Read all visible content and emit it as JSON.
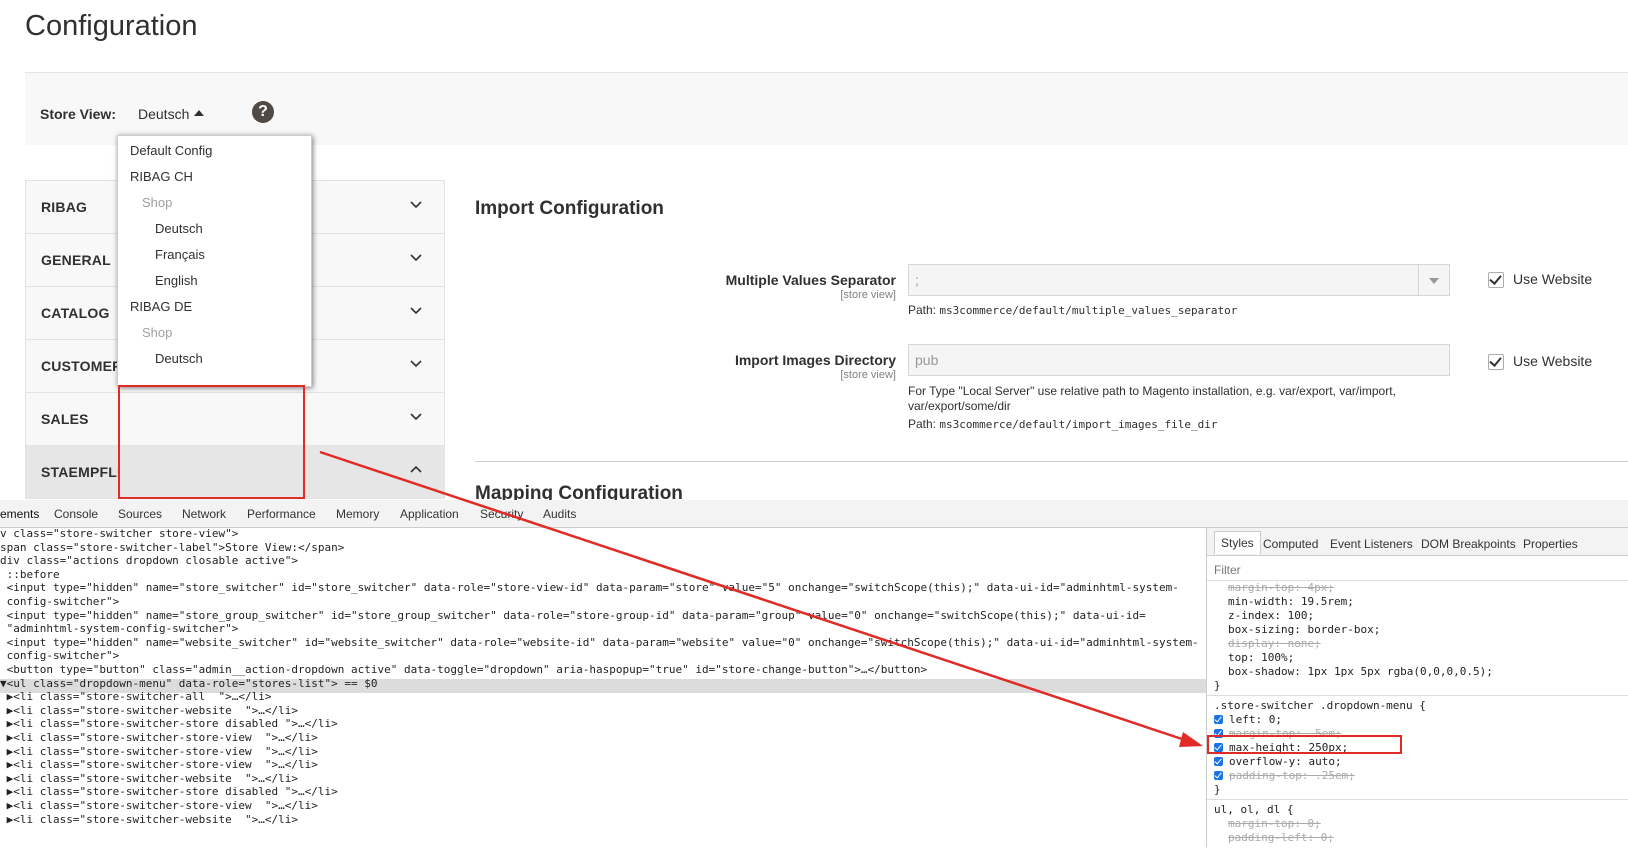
{
  "page": {
    "title": "Configuration"
  },
  "store_switcher": {
    "label": "Store View:",
    "value": "Deutsch",
    "help_icon_glyph": "?",
    "options": [
      {
        "label": "Default Config",
        "disabled": false,
        "level": 0
      },
      {
        "label": "RIBAG CH",
        "disabled": false,
        "level": 0
      },
      {
        "label": "Shop",
        "disabled": true,
        "level": 1
      },
      {
        "label": "Deutsch",
        "disabled": false,
        "level": 2
      },
      {
        "label": "Français",
        "disabled": false,
        "level": 2
      },
      {
        "label": "English",
        "disabled": false,
        "level": 2
      },
      {
        "label": "RIBAG DE",
        "disabled": false,
        "level": 0
      },
      {
        "label": "Shop",
        "disabled": true,
        "level": 1
      },
      {
        "label": "Deutsch",
        "disabled": false,
        "level": 2
      }
    ]
  },
  "sidebar": {
    "tabs": [
      {
        "label": "RIBAG",
        "expanded": false
      },
      {
        "label": "GENERAL",
        "expanded": false
      },
      {
        "label": "CATALOG",
        "expanded": false
      },
      {
        "label": "CUSTOMERS",
        "expanded": false
      },
      {
        "label": "SALES",
        "expanded": false
      },
      {
        "label": "STAEMPFLI",
        "expanded": true
      }
    ]
  },
  "main": {
    "section1_title": "Import Configuration",
    "fields": [
      {
        "label": "Multiple Values Separator",
        "scope": "[store view]",
        "value": ";",
        "path_label": "Path:",
        "path": "ms3commerce/default/multiple_values_separator",
        "use_website_label": "Use Website",
        "use_website_checked": true
      },
      {
        "label": "Import Images Directory",
        "scope": "[store view]",
        "value": "pub",
        "note": "For Type \"Local Server\" use relative path to Magento installation, e.g. var/export, var/import, var/export/some/dir",
        "path_label": "Path:",
        "path": "ms3commerce/default/import_images_file_dir",
        "use_website_label": "Use Website",
        "use_website_checked": true
      }
    ],
    "section2_title": "Mapping Configuration"
  },
  "devtools": {
    "tabs": [
      "ements",
      "Console",
      "Sources",
      "Network",
      "Performance",
      "Memory",
      "Application",
      "Security",
      "Audits"
    ],
    "elements_lines": [
      "v class=\"store-switcher store-view\">",
      "span class=\"store-switcher-label\">Store View:</span>",
      "div class=\"actions dropdown closable active\">",
      " ::before",
      " <input type=\"hidden\" name=\"store_switcher\" id=\"store_switcher\" data-role=\"store-view-id\" data-param=\"store\" value=\"5\" onchange=\"switchScope(this);\" data-ui-id=\"adminhtml-system-",
      " config-switcher\">",
      " <input type=\"hidden\" name=\"store_group_switcher\" id=\"store_group_switcher\" data-role=\"store-group-id\" data-param=\"group\" value=\"0\" onchange=\"switchScope(this);\" data-ui-id=",
      " \"adminhtml-system-config-switcher\">",
      " <input type=\"hidden\" name=\"website_switcher\" id=\"website_switcher\" data-role=\"website-id\" data-param=\"website\" value=\"0\" onchange=\"switchScope(this);\" data-ui-id=\"adminhtml-system-",
      " config-switcher\">",
      " <button type=\"button\" class=\"admin__action-dropdown active\" data-toggle=\"dropdown\" aria-haspopup=\"true\" id=\"store-change-button\">…</button>",
      "▼<ul class=\"dropdown-menu\" data-role=\"stores-list\"> == $0",
      " ▶<li class=\"store-switcher-all  \">…</li>",
      " ▶<li class=\"store-switcher-website  \">…</li>",
      " ▶<li class=\"store-switcher-store disabled \">…</li>",
      " ▶<li class=\"store-switcher-store-view  \">…</li>",
      " ▶<li class=\"store-switcher-store-view  \">…</li>",
      " ▶<li class=\"store-switcher-store-view  \">…</li>",
      " ▶<li class=\"store-switcher-website  \">…</li>",
      " ▶<li class=\"store-switcher-store disabled \">…</li>",
      " ▶<li class=\"store-switcher-store-view  \">…</li>",
      " ▶<li class=\"store-switcher-website  \">…</li>"
    ],
    "styles_tabs": [
      "Styles",
      "Computed",
      "Event Listeners",
      "DOM Breakpoints",
      "Properties"
    ],
    "filter_placeholder": "Filter",
    "style_lines_top": [
      {
        "text": "margin-top: 4px;",
        "struck": true
      },
      {
        "text": "min-width: 19.5rem;",
        "struck": false
      },
      {
        "text": "z-index: 100;",
        "struck": false
      },
      {
        "text": "box-sizing: border-box;",
        "struck": false
      },
      {
        "text": "display: none;",
        "struck": true
      },
      {
        "text": "top: 100%;",
        "struck": false
      },
      {
        "text": "box-shadow: 1px 1px 5px rgba(0,0,0,0.5);",
        "struck": false
      }
    ],
    "close_brace": "}",
    "rule2_selector": ".store-switcher .dropdown-menu {",
    "rule2_props": [
      {
        "text": "left: 0;",
        "struck": false
      },
      {
        "text": "margin-top: .5em;",
        "struck": true
      },
      {
        "text": "max-height: 250px;",
        "struck": false
      },
      {
        "text": "overflow-y: auto;",
        "struck": false
      },
      {
        "text": "padding-top: .25em;",
        "struck": true
      }
    ],
    "rule3_selector": "ul, ol, dl {",
    "rule3_props": [
      {
        "text": "margin-top: 0;",
        "struck": true
      },
      {
        "text": "padding-left: 0;",
        "struck": true
      }
    ]
  },
  "colors": {
    "annotation_red": "#e02b27",
    "checkbox_blue": "#1a73e8"
  }
}
